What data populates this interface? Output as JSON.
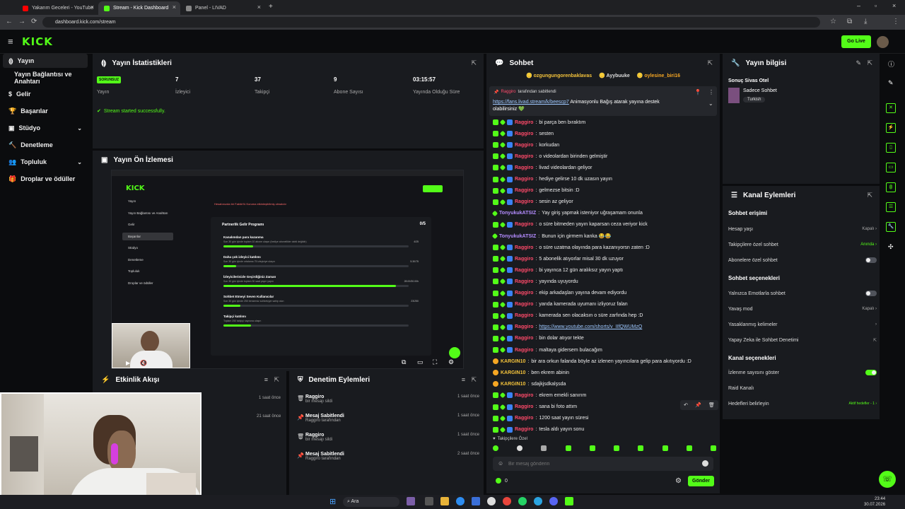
{
  "browser": {
    "tabs": [
      {
        "title": "Yakarım Geceleri - YouTube",
        "color": "#ff0000"
      },
      {
        "title": "Stream - Kick Dashboard",
        "color": "#53fc18"
      },
      {
        "title": "Panel - LIVAD",
        "color": "#888888"
      }
    ],
    "url": "dashboard.kick.com/stream"
  },
  "header": {
    "logo": "KICK",
    "go_live": "Go Live"
  },
  "sidebar": {
    "items": [
      {
        "label": "Yayın"
      },
      {
        "label": "Yayın Bağlantısı ve Anahtarı"
      },
      {
        "label": "Gelir"
      },
      {
        "label": "Başarılar"
      },
      {
        "label": "Stüdyo"
      },
      {
        "label": "Denetleme"
      },
      {
        "label": "Topluluk"
      },
      {
        "label": "Droplar ve ödüller"
      }
    ]
  },
  "stats": {
    "title": "Yayın İstatistikleri",
    "status_badge": "SORUNSUZ",
    "stream_label": "Yayın",
    "viewers_value": "7",
    "viewers_label": "İzleyici",
    "followers_value": "37",
    "followers_label": "Takipçi",
    "subs_value": "9",
    "subs_label": "Abone Sayısı",
    "uptime_value": "03:15:57",
    "uptime_label": "Yayında Olduğu Süre",
    "success_msg": "Stream started successfully."
  },
  "preview": {
    "title": "Yayın Ön İzlemesi",
    "inner_logo": "KICK",
    "inner_menu": [
      "Yayın",
      "Yayın Bağlantısı ve Anahtarı",
      "Gelir",
      "Başarılar",
      "Stüdyo",
      "Denetleme",
      "Topluluk",
      "Droplar ve ödüller"
    ],
    "inner_alert": "Hesabınızda bir Faktör'lü Koruma etkinleştirilmiş olmalıdır",
    "program_title": "Partnerlik Gelir Programı",
    "program_count": "0/5",
    "goals": [
      {
        "title": "Kanalımdan para kazanma",
        "desc": "Son 30 gün içinde toplam 10 abone ulaşın (hediye abonelikler dahil değildir)",
        "count": "4/25",
        "progress": 0.16
      },
      {
        "title": "Daha çok izleyici katılımı",
        "desc": "Son 30 gün içinde ortalama 75 izleyiciye ulaşın",
        "count": "5.30/75",
        "progress": 0.07
      },
      {
        "title": "İzleyicilerinizle Geçirdiğiniz Zaman",
        "desc": "Son 30 gün içinde toplam 30 saat yayın yapın",
        "count": "28.00/30.00h",
        "progress": 0.93
      },
      {
        "title": "Sohbet Etmeyi Seven Kullanıcılar",
        "desc": "Son 30 gün içinde 250 benzersiz sohbetçiye sahip olun",
        "count": "23/250",
        "progress": 0.09
      },
      {
        "title": "Takipçi katılımı",
        "desc": "Toplam 250 takipçi sayısına ulaşın",
        "count": "",
        "progress": 0.15
      }
    ]
  },
  "activity": {
    "title": "Etkinlik Akışı",
    "times": [
      "1 saat önce",
      "21 saat önce"
    ]
  },
  "mod_actions": {
    "title": "Denetim Eylemleri",
    "rows": [
      {
        "t1": "Raggiro",
        "t2": "bir mesajı sildi",
        "time": "1 saat önce"
      },
      {
        "t1": "Mesaj Sabitlendi",
        "t2": "Raggiro tarafından",
        "time": "1 saat önce"
      },
      {
        "t1": "Raggiro",
        "t2": "bir mesajı sildi",
        "time": "1 saat önce"
      },
      {
        "t1": "Mesaj Sabitlendi",
        "t2": "Raggiro tarafından",
        "time": "2 saat önce"
      }
    ]
  },
  "chat": {
    "title": "Sohbet",
    "top_gifters": [
      "ozgungungorenbaklavas",
      "Ayybuuke",
      "oylesine_biri16"
    ],
    "pinned_by": "Raggiro",
    "pinned_by_suffix": "tarafından sabitlendi",
    "pinned_link": "https://fans.livad.stream/k/beescp7",
    "pinned_text": "Animasyonlu Bağış atarak yayına destek olabilirsiniz 💚",
    "messages": [
      {
        "user": "Raggiro",
        "text": "bi parça ben bıraktım",
        "type": "r"
      },
      {
        "user": "Raggiro",
        "text": "sesten",
        "type": "r"
      },
      {
        "user": "Raggiro",
        "text": "korkudan",
        "type": "r"
      },
      {
        "user": "Raggiro",
        "text": "o videolardan birinden gelmiştir",
        "type": "r"
      },
      {
        "user": "Raggiro",
        "text": "livad videolardan geliyor",
        "type": "r"
      },
      {
        "user": "Raggiro",
        "text": "hediye gelirse 10 dk uzasın yayın",
        "type": "r"
      },
      {
        "user": "Raggiro",
        "text": "gelmezse bitsin :D",
        "type": "r"
      },
      {
        "user": "Raggiro",
        "text": "sesin az geliyor",
        "type": "r"
      },
      {
        "user": "TonyukukATSIZ",
        "text": "Yay giriş yapmak isteniyor uğraşamam onunla",
        "type": "p"
      },
      {
        "user": "Raggiro",
        "text": "o süre bitmeden yayın kaparsan ceza veriyor kick",
        "type": "r"
      },
      {
        "user": "TonyukukATSIZ",
        "text": "Bunun için girmem kanka 😂😂",
        "type": "p"
      },
      {
        "user": "Raggiro",
        "text": "o süre uzatma olayında para kazanıyorsn zaten :D",
        "type": "r"
      },
      {
        "user": "Raggiro",
        "text": "5 abonelik atıyorlar misal 30 dk uzuyor",
        "type": "r"
      },
      {
        "user": "Raggiro",
        "text": "bi yayınca 12 gün aralıksız yayın yaptı",
        "type": "r"
      },
      {
        "user": "Raggiro",
        "text": "yayında uyuyordu",
        "type": "r"
      },
      {
        "user": "Raggiro",
        "text": "ekip arkadaşları yayına devam ediyordu",
        "type": "r"
      },
      {
        "user": "Raggiro",
        "text": "yanda kamerada uyumanı izliyoruz falan",
        "type": "r"
      },
      {
        "user": "Raggiro",
        "text": "kamerada sen olacaksın o süre zarfında hep :D",
        "type": "r"
      },
      {
        "user": "Raggiro",
        "text": "https://www.youtube.com/shorts/v_IIfQWUMzQ",
        "type": "rl"
      },
      {
        "user": "Raggiro",
        "text": "bin dolar atıyor tekte",
        "type": "r"
      },
      {
        "user": "Raggiro",
        "text": "maltaya gidersem bulacağım",
        "type": "r"
      },
      {
        "user": "KARGIN10",
        "text": "bir ara orkun falanda böyle az izlenen yayıncılara gelip para akıtıyordu :D",
        "type": "g"
      },
      {
        "user": "KARGIN10",
        "text": "ben ekrem abinin",
        "type": "g"
      },
      {
        "user": "KARGIN10",
        "text": "sdajkjsdkalşsda",
        "type": "g"
      },
      {
        "user": "Raggiro",
        "text": "ekrem emekli sanırım",
        "type": "r"
      },
      {
        "user": "Raggiro",
        "text": "sana bi foto attım",
        "type": "r"
      },
      {
        "user": "Raggiro",
        "text": "1200 saat yayın süresi",
        "type": "r"
      },
      {
        "user": "Raggiro",
        "text": "tesla aldı yayın sonu",
        "type": "r"
      }
    ],
    "followers_only": "Takipçilere Özel",
    "input_placeholder": "Bir mesaj gönderin",
    "points": "0",
    "send": "Gönder"
  },
  "stream_info": {
    "title": "Yayın bilgisi",
    "stream_title": "Sonuç Sivas Otel",
    "category": "Sadece Sohbet",
    "language": "Turkish"
  },
  "channel_actions": {
    "title": "Kanal Eylemleri",
    "chat_access": "Sohbet erişimi",
    "account_age": "Hesap yaşı",
    "account_age_val": "Kapalı",
    "followers_chat": "Takipçilere özel sohbet",
    "followers_chat_val": "Anında",
    "subs_chat": "Abonelere özel sohbet",
    "chat_options": "Sohbet seçenekleri",
    "emotes_only": "Yalnızca Emotlarla sohbet",
    "slow_mode": "Yavaş mod",
    "slow_mode_val": "Kapalı",
    "banned_words": "Yasaklanmış kelimeler",
    "ai_mod": "Yapay Zeka ile Sohbet Denetimi",
    "channel_options": "Kanal seçenekleri",
    "show_viewers": "İzlenme sayısını göster",
    "raid": "Raid Kanalı",
    "goals": "Hedefleri belirleyin",
    "goals_val": "Aktif hedefler - 1"
  },
  "taskbar": {
    "search": "Ara",
    "time": "23:44",
    "date": "30.07.2026"
  }
}
